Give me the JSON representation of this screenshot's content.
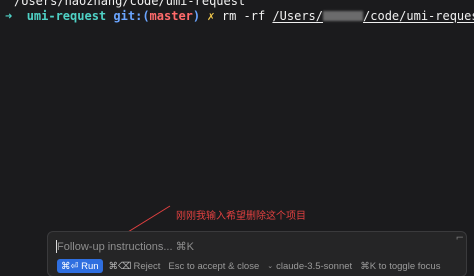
{
  "terminal": {
    "previous_line": "/Users/haozhang/code/umi-request",
    "prompt_arrow": "➜",
    "directory": "umi-request",
    "git_label": "git:",
    "branch_open": "(",
    "branch_name": "master",
    "branch_close": ")",
    "dirty_mark": "✗",
    "command": "rm -rf",
    "path_prefix": "/Users/",
    "path_suffix": "/code/umi-request"
  },
  "annotation": {
    "text": "刚刚我输入希望删除这个项目",
    "color": "#e04040"
  },
  "followup": {
    "placeholder": "Follow-up instructions... ⌘K",
    "close_glyph": "⌐",
    "run_shortcut": "⌘⏎",
    "run_label": "Run",
    "reject_shortcut": "⌘⌫",
    "reject_label": "Reject",
    "esc_label": "Esc to accept & close",
    "model_chevron": "⌄",
    "model_name": "claude-3.5-sonnet",
    "toggle_label": "⌘K to toggle focus"
  },
  "colors": {
    "background": "#1b1b1d",
    "accent": "#2f6fe0",
    "dir": "#4fd1c5",
    "git": "#6aa5ff",
    "branch": "#ff6b6b",
    "dirty": "#f2c94c"
  }
}
